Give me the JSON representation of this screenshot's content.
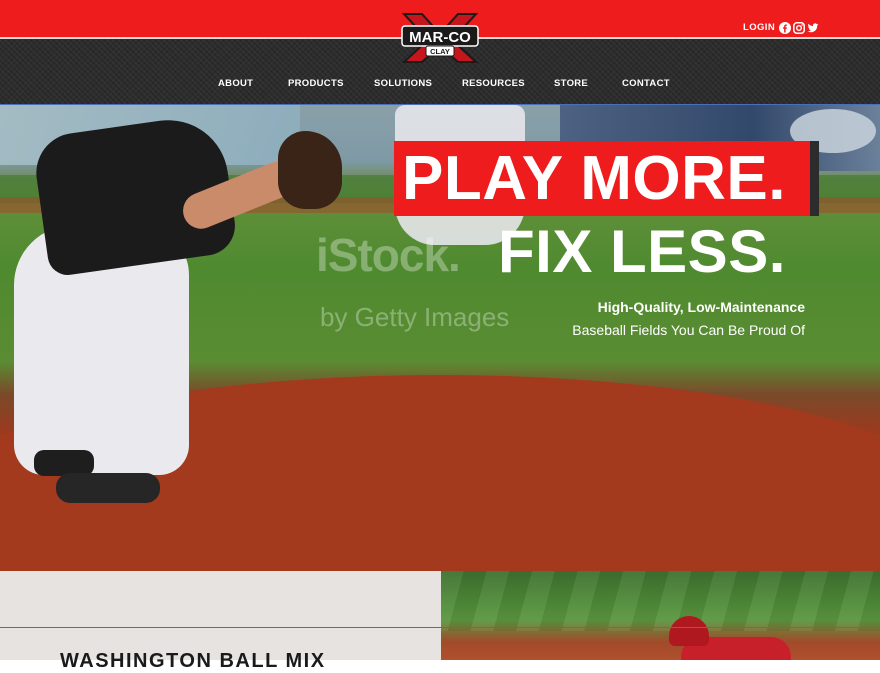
{
  "brand": {
    "logo_top": "MAR-CO",
    "logo_bottom": "CLAY",
    "red": "#ee1c1c",
    "dark": "#2c2c2c"
  },
  "header": {
    "login_label": "LOGIN",
    "social_icons": [
      "facebook-icon",
      "instagram-icon",
      "twitter-icon"
    ]
  },
  "nav": {
    "items": [
      {
        "label": "ABOUT"
      },
      {
        "label": "PRODUCTS"
      },
      {
        "label": "SOLUTIONS"
      },
      {
        "label": "RESOURCES"
      },
      {
        "label": "STORE"
      },
      {
        "label": "CONTACT"
      }
    ]
  },
  "hero": {
    "headline_line1": "PLAY MORE.",
    "headline_line2": "FIX LESS.",
    "subtitle_bold": "High-Quality, Low-Maintenance",
    "subtitle": "Baseball Fields You Can Be Proud Of",
    "watermark_line1": "iStock.",
    "watermark_line2": "by Getty Images"
  },
  "section": {
    "title": "WASHINGTON BALL MIX"
  }
}
